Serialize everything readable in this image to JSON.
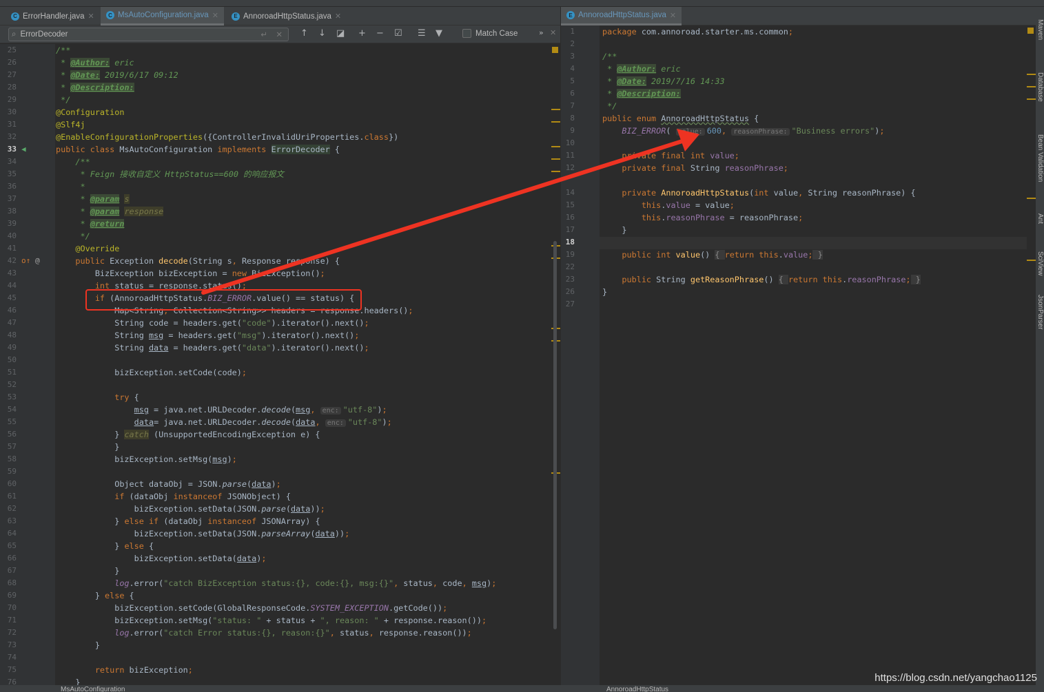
{
  "left_tabs": [
    {
      "label": "ErrorHandler.java",
      "icon": "C",
      "active": false
    },
    {
      "label": "MsAutoConfiguration.java",
      "icon": "C",
      "active": true
    },
    {
      "label": "AnnoroadHttpStatus.java",
      "icon": "E",
      "active": false
    }
  ],
  "right_tabs": [
    {
      "label": "AnnoroadHttpStatus.java",
      "icon": "E",
      "active": true
    }
  ],
  "search": {
    "value": "ErrorDecoder",
    "match_case_label": "Match Case",
    "match_case_checked": false,
    "more": "»"
  },
  "colors": {
    "accent": "#6897bb",
    "annotation_red": "#ee3322",
    "keyword": "#cc7832",
    "string": "#6a8759"
  },
  "left_code": [
    {
      "n": "25",
      "t": [
        [
          "d",
          "/**"
        ]
      ]
    },
    {
      "n": "26",
      "t": [
        [
          "d",
          " * "
        ],
        [
          "t",
          "@Author:"
        ],
        [
          "d",
          " eric"
        ]
      ]
    },
    {
      "n": "27",
      "t": [
        [
          "d",
          " * "
        ],
        [
          "t",
          "@Date:"
        ],
        [
          "d",
          " 2019/6/17 09:12"
        ]
      ]
    },
    {
      "n": "28",
      "t": [
        [
          "d",
          " * "
        ],
        [
          "t",
          "@Description:"
        ]
      ]
    },
    {
      "n": "29",
      "t": [
        [
          "d",
          " */"
        ]
      ]
    },
    {
      "n": "30",
      "t": [
        [
          "a",
          "@Configuration"
        ]
      ]
    },
    {
      "n": "31",
      "t": [
        [
          "a",
          "@Slf4j"
        ]
      ]
    },
    {
      "n": "32",
      "t": [
        [
          "a",
          "@EnableConfigurationProperties"
        ],
        [
          "p",
          "({ControllerInvalidUriProperties."
        ],
        [
          "k",
          "class"
        ],
        [
          "p",
          "})"
        ]
      ]
    },
    {
      "n": "33",
      "t": [
        [
          "k",
          "public class "
        ],
        [
          "p",
          "MsAutoConfiguration "
        ],
        [
          "k",
          "implements "
        ],
        [
          "hl",
          "ErrorDecoder"
        ],
        [
          "p",
          " {"
        ]
      ]
    },
    {
      "n": "34",
      "t": [
        [
          "d",
          "    /**"
        ]
      ]
    },
    {
      "n": "35",
      "t": [
        [
          "d",
          "     * Feign 接收自定义 HttpStatus==600 的响应报文"
        ]
      ]
    },
    {
      "n": "36",
      "t": [
        [
          "d",
          "     *"
        ]
      ]
    },
    {
      "n": "37",
      "t": [
        [
          "d",
          "     * "
        ],
        [
          "t",
          "@param"
        ],
        [
          "d",
          " "
        ],
        [
          "tb",
          "s"
        ]
      ]
    },
    {
      "n": "38",
      "t": [
        [
          "d",
          "     * "
        ],
        [
          "t",
          "@param"
        ],
        [
          "d",
          " "
        ],
        [
          "tb",
          "response"
        ]
      ]
    },
    {
      "n": "39",
      "t": [
        [
          "d",
          "     * "
        ],
        [
          "t",
          "@return"
        ]
      ]
    },
    {
      "n": "40",
      "t": [
        [
          "d",
          "     */"
        ]
      ]
    },
    {
      "n": "41",
      "t": [
        [
          "a",
          "    @Override"
        ]
      ]
    },
    {
      "n": "42",
      "t": [
        [
          "k",
          "    public "
        ],
        [
          "p",
          "Exception "
        ],
        [
          "m",
          "decode"
        ],
        [
          "p",
          "(String s"
        ],
        [
          "k",
          ", "
        ],
        [
          "p",
          "Response response) {"
        ]
      ]
    },
    {
      "n": "43",
      "t": [
        [
          "p",
          "        BizException bizException = "
        ],
        [
          "k",
          "new "
        ],
        [
          "p",
          "BizException()"
        ],
        [
          "k",
          ";"
        ]
      ]
    },
    {
      "n": "44",
      "t": [
        [
          "k",
          "        int "
        ],
        [
          "p",
          "status = response.status()"
        ],
        [
          "k",
          ";"
        ]
      ]
    },
    {
      "n": "45",
      "t": [
        [
          "k",
          "        if "
        ],
        [
          "p",
          "(AnnoroadHttpStatus."
        ],
        [
          "c",
          "BIZ_ERROR"
        ],
        [
          "p",
          ".value() == status) {"
        ]
      ]
    },
    {
      "n": "46",
      "t": [
        [
          "p",
          "            Map<String"
        ],
        [
          "k",
          ", "
        ],
        [
          "p",
          "Collection<String>> headers = response.headers()"
        ],
        [
          "k",
          ";"
        ]
      ]
    },
    {
      "n": "47",
      "t": [
        [
          "p",
          "            String code = headers.get("
        ],
        [
          "s",
          "\"code\""
        ],
        [
          "p",
          ").iterator().next()"
        ],
        [
          "k",
          ";"
        ]
      ]
    },
    {
      "n": "48",
      "t": [
        [
          "p",
          "            String "
        ],
        [
          "u",
          "msg"
        ],
        [
          "p",
          " = headers.get("
        ],
        [
          "s",
          "\"msg\""
        ],
        [
          "p",
          ").iterator().next()"
        ],
        [
          "k",
          ";"
        ]
      ]
    },
    {
      "n": "49",
      "t": [
        [
          "p",
          "            String "
        ],
        [
          "u",
          "data"
        ],
        [
          "p",
          " = headers.get("
        ],
        [
          "s",
          "\"data\""
        ],
        [
          "p",
          ").iterator().next()"
        ],
        [
          "k",
          ";"
        ]
      ]
    },
    {
      "n": "50",
      "t": []
    },
    {
      "n": "51",
      "t": [
        [
          "p",
          "            bizException.setCode(code)"
        ],
        [
          "k",
          ";"
        ]
      ]
    },
    {
      "n": "52",
      "t": []
    },
    {
      "n": "53",
      "t": [
        [
          "k",
          "            try "
        ],
        [
          "p",
          "{"
        ]
      ]
    },
    {
      "n": "54",
      "t": [
        [
          "p",
          "                "
        ],
        [
          "u",
          "msg"
        ],
        [
          "p",
          " = java.net.URLDecoder."
        ],
        [
          "i",
          "decode"
        ],
        [
          "p",
          "("
        ],
        [
          "u",
          "msg"
        ],
        [
          "k",
          ", "
        ],
        [
          "h",
          "enc:"
        ],
        [
          "s",
          "\"utf-8\""
        ],
        [
          "p",
          ")"
        ],
        [
          "k",
          ";"
        ]
      ]
    },
    {
      "n": "55",
      "t": [
        [
          "p",
          "                "
        ],
        [
          "u",
          "data"
        ],
        [
          "p",
          "= java.net.URLDecoder."
        ],
        [
          "i",
          "decode"
        ],
        [
          "p",
          "("
        ],
        [
          "u",
          "data"
        ],
        [
          "k",
          ", "
        ],
        [
          "h",
          "enc:"
        ],
        [
          "s",
          "\"utf-8\""
        ],
        [
          "p",
          ")"
        ],
        [
          "k",
          ";"
        ]
      ]
    },
    {
      "n": "56",
      "t": [
        [
          "p",
          "            } "
        ],
        [
          "tb",
          "catch"
        ],
        [
          "p",
          " (UnsupportedEncodingException e) {"
        ]
      ]
    },
    {
      "n": "57",
      "t": [
        [
          "p",
          "            }"
        ]
      ]
    },
    {
      "n": "58",
      "t": [
        [
          "p",
          "            bizException.setMsg("
        ],
        [
          "u",
          "msg"
        ],
        [
          "p",
          ")"
        ],
        [
          "k",
          ";"
        ]
      ]
    },
    {
      "n": "59",
      "t": []
    },
    {
      "n": "60",
      "t": [
        [
          "p",
          "            Object dataObj = JSON."
        ],
        [
          "i",
          "parse"
        ],
        [
          "p",
          "("
        ],
        [
          "u",
          "data"
        ],
        [
          "p",
          ")"
        ],
        [
          "k",
          ";"
        ]
      ]
    },
    {
      "n": "61",
      "t": [
        [
          "k",
          "            if "
        ],
        [
          "p",
          "(dataObj "
        ],
        [
          "k",
          "instanceof "
        ],
        [
          "p",
          "JSONObject) {"
        ]
      ]
    },
    {
      "n": "62",
      "t": [
        [
          "p",
          "                bizException.setData(JSON."
        ],
        [
          "i",
          "parse"
        ],
        [
          "p",
          "("
        ],
        [
          "u",
          "data"
        ],
        [
          "p",
          "))"
        ],
        [
          "k",
          ";"
        ]
      ]
    },
    {
      "n": "63",
      "t": [
        [
          "p",
          "            } "
        ],
        [
          "k",
          "else if "
        ],
        [
          "p",
          "(dataObj "
        ],
        [
          "k",
          "instanceof "
        ],
        [
          "p",
          "JSONArray) {"
        ]
      ]
    },
    {
      "n": "64",
      "t": [
        [
          "p",
          "                bizException.setData(JSON."
        ],
        [
          "i",
          "parseArray"
        ],
        [
          "p",
          "("
        ],
        [
          "u",
          "data"
        ],
        [
          "p",
          "))"
        ],
        [
          "k",
          ";"
        ]
      ]
    },
    {
      "n": "65",
      "t": [
        [
          "p",
          "            } "
        ],
        [
          "k",
          "else "
        ],
        [
          "p",
          "{"
        ]
      ]
    },
    {
      "n": "66",
      "t": [
        [
          "p",
          "                bizException.setData("
        ],
        [
          "u",
          "data"
        ],
        [
          "p",
          ")"
        ],
        [
          "k",
          ";"
        ]
      ]
    },
    {
      "n": "67",
      "t": [
        [
          "p",
          "            }"
        ]
      ]
    },
    {
      "n": "68",
      "t": [
        [
          "lf",
          "            log"
        ],
        [
          "p",
          ".error("
        ],
        [
          "s",
          "\"catch BizException status:{}, code:{}, msg:{}\""
        ],
        [
          "k",
          ", "
        ],
        [
          "p",
          "status"
        ],
        [
          "k",
          ", "
        ],
        [
          "p",
          "code"
        ],
        [
          "k",
          ", "
        ],
        [
          "u",
          "msg"
        ],
        [
          "p",
          ")"
        ],
        [
          "k",
          ";"
        ]
      ]
    },
    {
      "n": "69",
      "t": [
        [
          "p",
          "        } "
        ],
        [
          "k",
          "else "
        ],
        [
          "p",
          "{"
        ]
      ]
    },
    {
      "n": "70",
      "t": [
        [
          "p",
          "            bizException.setCode(GlobalResponseCode."
        ],
        [
          "c",
          "SYSTEM_EXCEPTION"
        ],
        [
          "p",
          ".getCode())"
        ],
        [
          "k",
          ";"
        ]
      ]
    },
    {
      "n": "71",
      "t": [
        [
          "p",
          "            bizException.setMsg("
        ],
        [
          "s",
          "\"status: \""
        ],
        [
          "p",
          " + status + "
        ],
        [
          "s",
          "\", reason: \""
        ],
        [
          "p",
          " + response.reason())"
        ],
        [
          "k",
          ";"
        ]
      ]
    },
    {
      "n": "72",
      "t": [
        [
          "lf",
          "            log"
        ],
        [
          "p",
          ".error("
        ],
        [
          "s",
          "\"catch Error status:{}, reason:{}\""
        ],
        [
          "k",
          ", "
        ],
        [
          "p",
          "status"
        ],
        [
          "k",
          ", "
        ],
        [
          "p",
          "response.reason())"
        ],
        [
          "k",
          ";"
        ]
      ]
    },
    {
      "n": "73",
      "t": [
        [
          "p",
          "        }"
        ]
      ]
    },
    {
      "n": "74",
      "t": []
    },
    {
      "n": "75",
      "t": [
        [
          "k",
          "        return "
        ],
        [
          "p",
          "bizException"
        ],
        [
          "k",
          ";"
        ]
      ]
    },
    {
      "n": "76",
      "t": [
        [
          "p",
          "    }"
        ]
      ]
    }
  ],
  "right_code": [
    {
      "n": "1",
      "t": [
        [
          "k",
          "package "
        ],
        [
          "p",
          "com.annoroad.starter.ms.common"
        ],
        [
          "k",
          ";"
        ]
      ]
    },
    {
      "n": "2",
      "t": []
    },
    {
      "n": "3",
      "t": [
        [
          "d",
          "/**"
        ]
      ]
    },
    {
      "n": "4",
      "t": [
        [
          "d",
          " * "
        ],
        [
          "t",
          "@Author:"
        ],
        [
          "d",
          " eric"
        ]
      ]
    },
    {
      "n": "5",
      "t": [
        [
          "d",
          " * "
        ],
        [
          "t",
          "@Date:"
        ],
        [
          "d",
          " 2019/7/16 14:33"
        ]
      ]
    },
    {
      "n": "6",
      "t": [
        [
          "d",
          " * "
        ],
        [
          "t",
          "@Description:"
        ]
      ]
    },
    {
      "n": "7",
      "t": [
        [
          "d",
          " */"
        ]
      ]
    },
    {
      "n": "8",
      "t": [
        [
          "k",
          "public enum "
        ],
        [
          "wav",
          "AnnoroadHttpStatus"
        ],
        [
          "p",
          " {"
        ]
      ]
    },
    {
      "n": "9",
      "t": [
        [
          "c",
          "    BIZ_ERROR"
        ],
        [
          "p",
          "( "
        ],
        [
          "h",
          "value:"
        ],
        [
          "n",
          "600"
        ],
        [
          "k",
          ", "
        ],
        [
          "h",
          "reasonPhrase:"
        ],
        [
          "s",
          "\"Business errors\""
        ],
        [
          "p",
          ")"
        ],
        [
          "k",
          ";"
        ]
      ]
    },
    {
      "n": "10",
      "t": []
    },
    {
      "n": "11",
      "t": [
        [
          "k",
          "    private final int "
        ],
        [
          "f",
          "value"
        ],
        [
          "k",
          ";"
        ]
      ]
    },
    {
      "n": "12",
      "t": [
        [
          "k",
          "    private final "
        ],
        [
          "p",
          "String "
        ],
        [
          "f",
          "reasonPhrase"
        ],
        [
          "k",
          ";"
        ]
      ]
    },
    {
      "n": "",
      "t": []
    },
    {
      "n": "14",
      "t": [
        [
          "k",
          "    private "
        ],
        [
          "m",
          "AnnoroadHttpStatus"
        ],
        [
          "p",
          "("
        ],
        [
          "k",
          "int "
        ],
        [
          "p",
          "value"
        ],
        [
          "k",
          ", "
        ],
        [
          "p",
          "String reasonPhrase) {"
        ]
      ]
    },
    {
      "n": "15",
      "t": [
        [
          "k",
          "        this"
        ],
        [
          "p",
          "."
        ],
        [
          "f",
          "value"
        ],
        [
          "p",
          " = value"
        ],
        [
          "k",
          ";"
        ]
      ]
    },
    {
      "n": "16",
      "t": [
        [
          "k",
          "        this"
        ],
        [
          "p",
          "."
        ],
        [
          "f",
          "reasonPhrase"
        ],
        [
          "p",
          " = reasonPhrase"
        ],
        [
          "k",
          ";"
        ]
      ]
    },
    {
      "n": "17",
      "t": [
        [
          "p",
          "    }"
        ]
      ]
    },
    {
      "n": "18",
      "t": []
    },
    {
      "n": "19",
      "t": [
        [
          "k",
          "    public int "
        ],
        [
          "m",
          "value"
        ],
        [
          "p",
          "() "
        ],
        [
          "fold",
          "{ "
        ],
        [
          "k",
          "return this"
        ],
        [
          "p",
          "."
        ],
        [
          "f",
          "value"
        ],
        [
          "k",
          ";"
        ],
        [
          "fold",
          " }"
        ]
      ]
    },
    {
      "n": "22",
      "t": []
    },
    {
      "n": "23",
      "t": [
        [
          "k",
          "    public "
        ],
        [
          "p",
          "String "
        ],
        [
          "m",
          "getReasonPhrase"
        ],
        [
          "p",
          "() "
        ],
        [
          "fold",
          "{ "
        ],
        [
          "k",
          "return this"
        ],
        [
          "p",
          "."
        ],
        [
          "f",
          "reasonPhrase"
        ],
        [
          "k",
          ";"
        ],
        [
          "fold",
          " }"
        ]
      ]
    },
    {
      "n": "26",
      "t": [
        [
          "p",
          "}"
        ]
      ]
    },
    {
      "n": "27",
      "t": []
    }
  ],
  "tool_windows": [
    "Maven",
    "Database",
    "Bean Validation",
    "Ant",
    "SciView",
    "JsonParser"
  ],
  "breadcrumbs": {
    "left": "MsAutoConfiguration",
    "right": "AnnoroadHttpStatus"
  },
  "watermark": "https://blog.csdn.net/yangchao1125"
}
